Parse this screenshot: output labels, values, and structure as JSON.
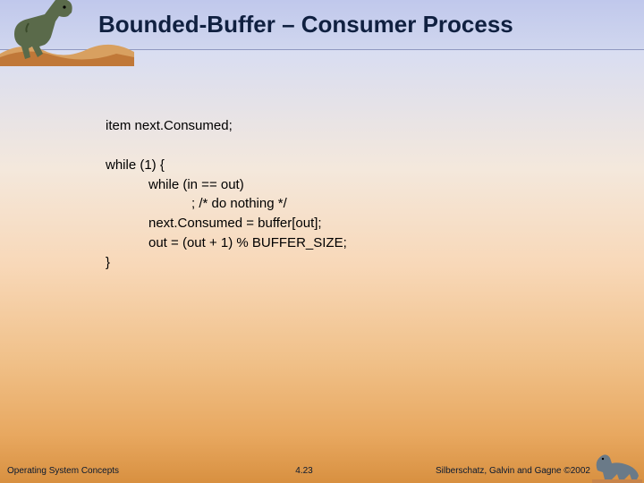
{
  "title": "Bounded-Buffer – Consumer Process",
  "code": {
    "decl": "item next.Consumed;",
    "l1": "while (1) {",
    "l2": "while (in == out)",
    "l3": "; /* do nothing */",
    "l4": "next.Consumed = buffer[out];",
    "l5": "out = (out + 1) % BUFFER_SIZE;",
    "l6": "}"
  },
  "footer": {
    "left": "Operating System Concepts",
    "page": "4.23",
    "right": "Silberschatz, Galvin and Gagne ©2002"
  },
  "icons": {
    "top_dino": "trex-icon",
    "bottom_dino": "sauropod-icon"
  }
}
